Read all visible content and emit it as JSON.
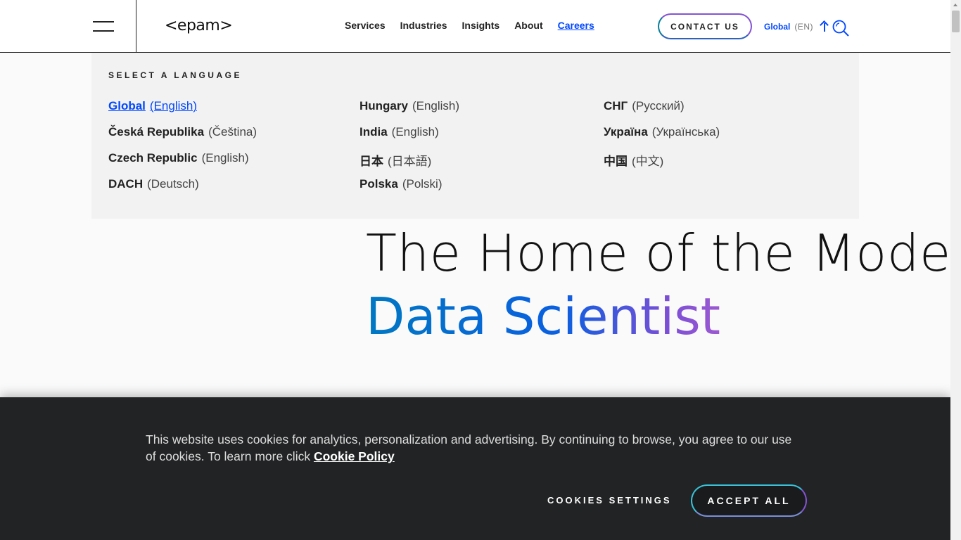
{
  "header": {
    "logo": "<epam>",
    "nav": [
      {
        "label": "Services"
      },
      {
        "label": "Industries"
      },
      {
        "label": "Insights"
      },
      {
        "label": "About"
      },
      {
        "label": "Careers",
        "active": true
      }
    ],
    "contact_label": "CONTACT US",
    "lang_current": "Global",
    "lang_code": "(EN)"
  },
  "language_panel": {
    "title": "SELECT A LANGUAGE",
    "columns": [
      [
        {
          "country": "Global",
          "language": "(English)",
          "selected": true
        },
        {
          "country": "Česká Republika",
          "language": "(Čeština)"
        },
        {
          "country": "Czech Republic",
          "language": "(English)"
        },
        {
          "country": "DACH",
          "language": "(Deutsch)"
        }
      ],
      [
        {
          "country": "Hungary",
          "language": "(English)"
        },
        {
          "country": "India",
          "language": "(English)"
        },
        {
          "country": "日本",
          "language": "(日本語)"
        },
        {
          "country": "Polska",
          "language": "(Polski)"
        }
      ],
      [
        {
          "country": "СНГ",
          "language": "(Русский)"
        },
        {
          "country": "Україна",
          "language": "(Українська)"
        },
        {
          "country": "中国",
          "language": "(中文)"
        }
      ]
    ]
  },
  "hero": {
    "line1": "The Home of the Modern",
    "line2": "Data Scientist"
  },
  "cookie_banner": {
    "text": "This website uses cookies for analytics, personalization and advertising. By continuing to browse, you agree to our use of cookies. To learn more click ",
    "link_label": "Cookie Policy",
    "settings_label": "COOKIES SETTINGS",
    "accept_label": "ACCEPT ALL"
  },
  "colors": {
    "accent_blue": "#0047ff",
    "banner_bg": "#222325",
    "panel_bg": "#f2f2f2"
  }
}
